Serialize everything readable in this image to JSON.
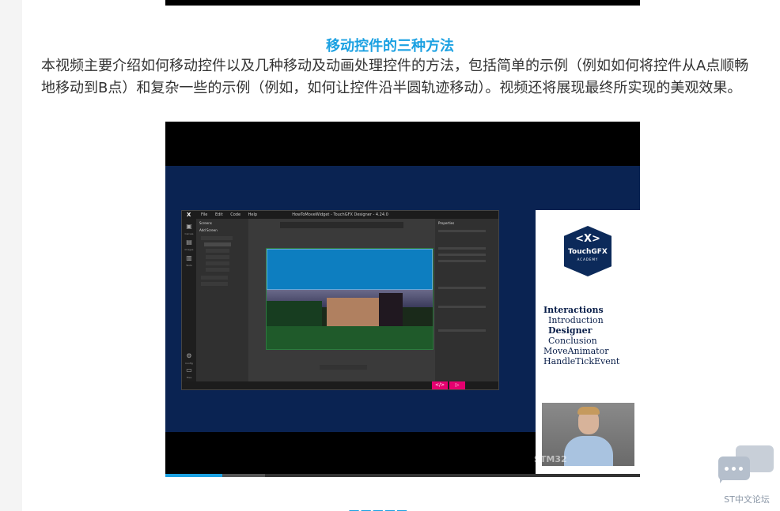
{
  "section": {
    "heading": "移动控件的三种方法",
    "paragraph": "本视频主要介绍如何移动控件以及几种移动及动画处理控件的方法，包括简单的示例（例如如何将控件从A点顺畅地移动到B点）和复杂一些的示例（例如，如何让控件沿半圆轨迹移动）。视频还将展现最终所实现的美观效果。"
  },
  "video": {
    "app_title": "HowToMoveWidget - TouchGFX Designer - 4.24.0",
    "app_logo": "X",
    "menus": [
      "File",
      "Edit",
      "Code",
      "Help"
    ],
    "rail": [
      "Canvas",
      "Images",
      "Texts",
      "Config",
      "Files"
    ],
    "tree_header": "Screens",
    "add_screen": "Add Screen",
    "properties_title": "Properties",
    "logo_mark": "<X>",
    "logo_name": "TouchGFX",
    "logo_sub": "ACADEMY",
    "agenda": [
      "Interactions",
      "Introduction",
      "Designer",
      "Conclusion",
      "MoveAnimator",
      "HandleTickEvent"
    ],
    "watermark": "STM32",
    "progress_fraction": 0.12,
    "buffered_fraction": 0.21,
    "colors": {
      "frame_bg": "#0a2352",
      "accent_pink": "#e5006f",
      "progress": "#1ba1e2"
    }
  },
  "forum": {
    "label": "ST中文论坛",
    "icon": "chat-bubbles-icon"
  },
  "colors": {
    "heading": "#1ba1e2",
    "body_text": "#333333"
  }
}
